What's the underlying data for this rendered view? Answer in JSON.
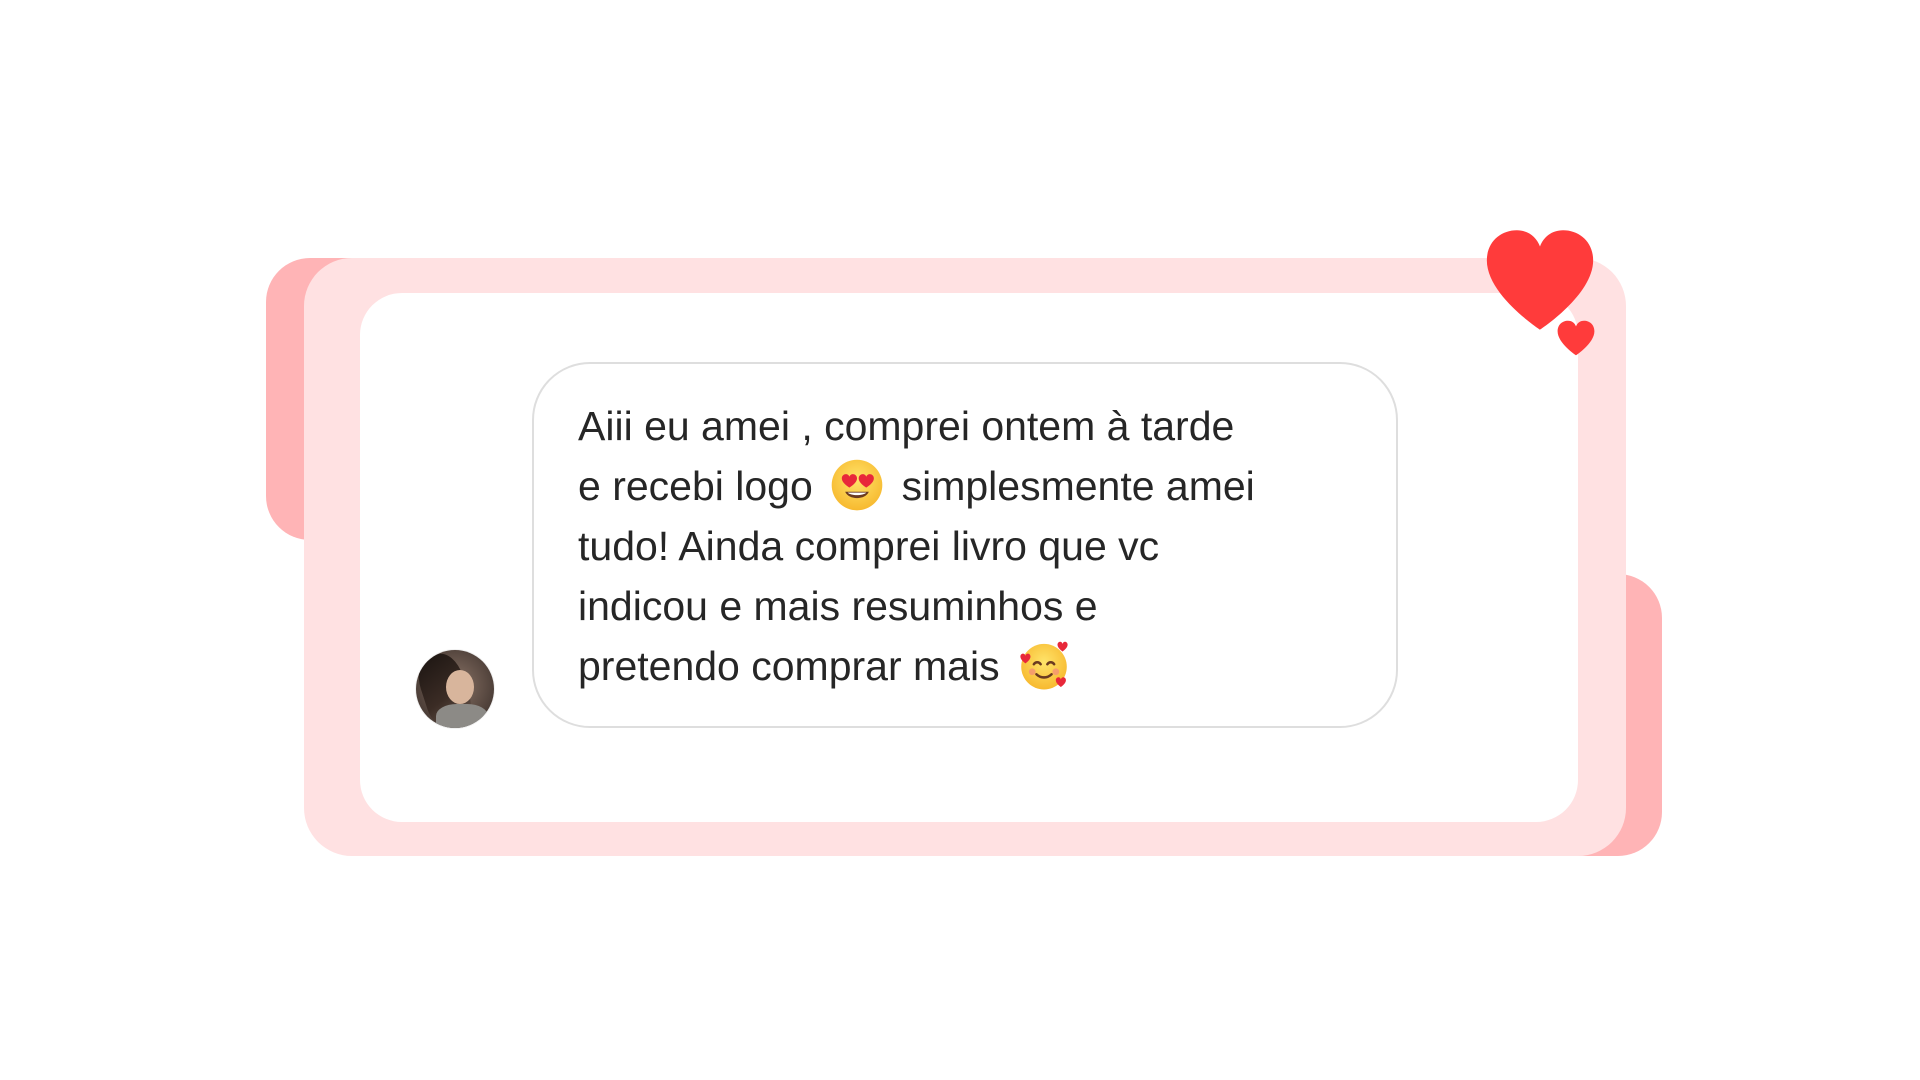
{
  "card": {
    "message_lines": [
      "Aiii eu amei , comprei ontem à tarde",
      "e recebi logo",
      "simplesmente amei",
      "tudo! Ainda comprei livro que vc",
      "indicou e mais resuminhos e",
      "pretendo comprar mais"
    ],
    "emojis": [
      "heart-eyes-emoji",
      "smiling-face-with-hearts-emoji"
    ]
  },
  "colors": {
    "background": "#ffffff",
    "back_shape": "#ffb4b6",
    "frame": "#ffe1e2",
    "bubble_border": "#dedede",
    "text": "#262626",
    "heart": "#ff3b3b"
  },
  "icons": {
    "big_heart": "heart-icon",
    "small_heart": "heart-icon",
    "avatar": "avatar"
  }
}
